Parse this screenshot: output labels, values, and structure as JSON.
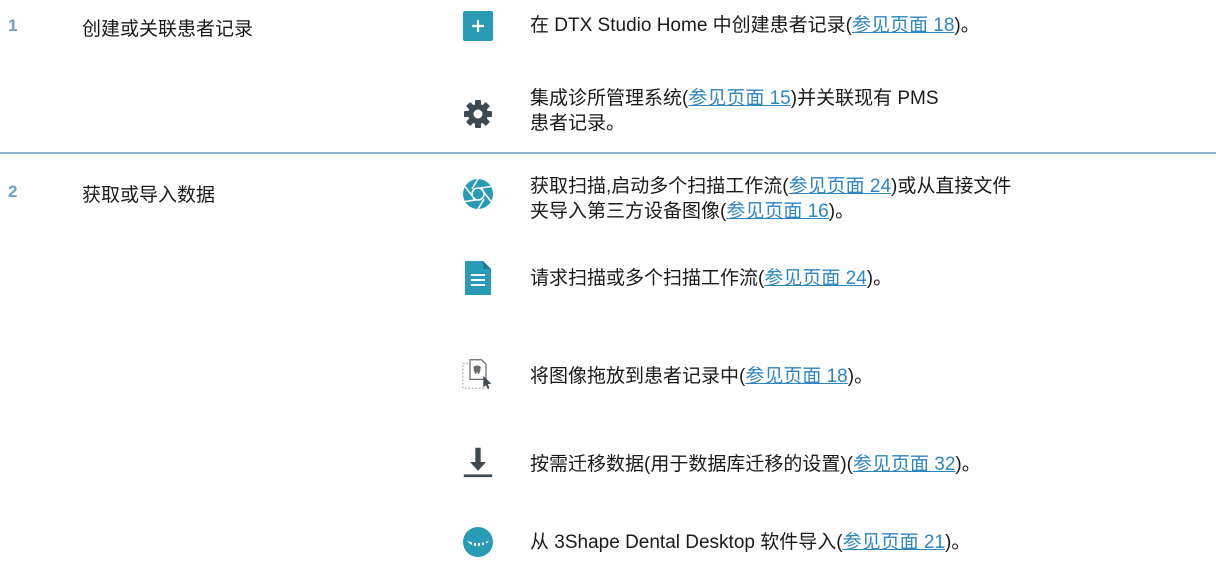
{
  "steps": [
    {
      "number": "1",
      "title": "创建或关联患者记录",
      "items": [
        {
          "icon": "plus-icon",
          "before": "在 DTX Studio Home 中创建患者记录(",
          "link": "参见页面 18",
          "after": ")。"
        },
        {
          "icon": "gear-icon",
          "before": "集成诊所管理系统(",
          "link": "参见页面 15",
          "after": ")并关联现有 PMS",
          "line2": "患者记录。"
        }
      ]
    },
    {
      "number": "2",
      "title": "获取或导入数据",
      "items": [
        {
          "icon": "camera-shutter-icon",
          "before": "获取扫描,启动多个扫描工作流(",
          "link": "参见页面 24",
          "after": ")或从直接文件",
          "line2_before": "夹导入第三方设备图像(",
          "line2_link": "参见页面 16",
          "line2_after": ")。"
        },
        {
          "icon": "document-icon",
          "before": "请求扫描或多个扫描工作流(",
          "link": "参见页面 24",
          "after": ")。"
        },
        {
          "icon": "drag-drop-image-icon",
          "before": "将图像拖放到患者记录中(",
          "link": "参见页面 18",
          "after": ")。"
        },
        {
          "icon": "download-icon",
          "before": "按需迁移数据(用于数据库迁移的设置)(",
          "link": "参见页面 32",
          "after": ")。"
        },
        {
          "icon": "dental-scan-icon",
          "before": "从 3Shape Dental Desktop 软件导入(",
          "link": "参见页面 21",
          "after": ")。"
        }
      ]
    }
  ],
  "colors": {
    "accent": "#2e86bf",
    "teal": "#2a9bb5",
    "icon_dark": "#3d4a52",
    "divider": "#8fb3cc",
    "step_number": "#6aa3c6"
  }
}
